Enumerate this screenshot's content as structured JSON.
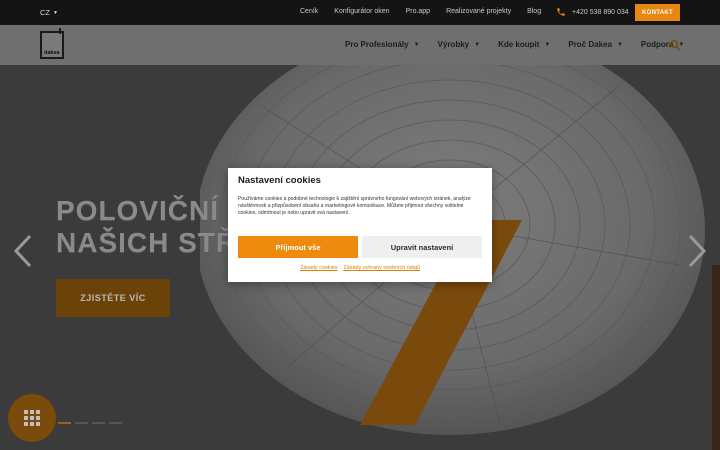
{
  "topbar": {
    "language": "CZ",
    "links": [
      "Ceník",
      "Konfigurátor oken",
      "Pro.app",
      "Realizované projekty",
      "Blog"
    ],
    "phone": "+420 538 890 034",
    "contact_button": "KONTAKT"
  },
  "nav": {
    "logo_text": "dakea",
    "items": [
      "Pro Profesionály",
      "Výrobky",
      "Kde koupit",
      "Proč Dakea",
      "Podpora"
    ]
  },
  "hero": {
    "title_line1": "POLOVIČNÍ C",
    "title_line2": "NAŠICH STŘ",
    "cta": "ZJISTĚTE VÍC"
  },
  "cookie_dialog": {
    "title": "Nastavení cookies",
    "body": "Používáme cookies a podobné technologie k zajištění správného fungování webových stránek, analýze návštěvnosti a přizpůsobení obsahu a marketingové komunikace. Můžete přijmout všechny volitelné cookies, odmítnout je nebo upravit svá nastavení.",
    "accept_button": "Přijmout vše",
    "settings_button": "Upravit nastavení",
    "link_cookies": "Zásady cookies",
    "link_privacy": "Zásady ochrany osobních údajů"
  },
  "colors": {
    "accent": "#ee8a0e",
    "topbar_bg": "#141414",
    "overlay_gray": "#6f6f6f"
  }
}
